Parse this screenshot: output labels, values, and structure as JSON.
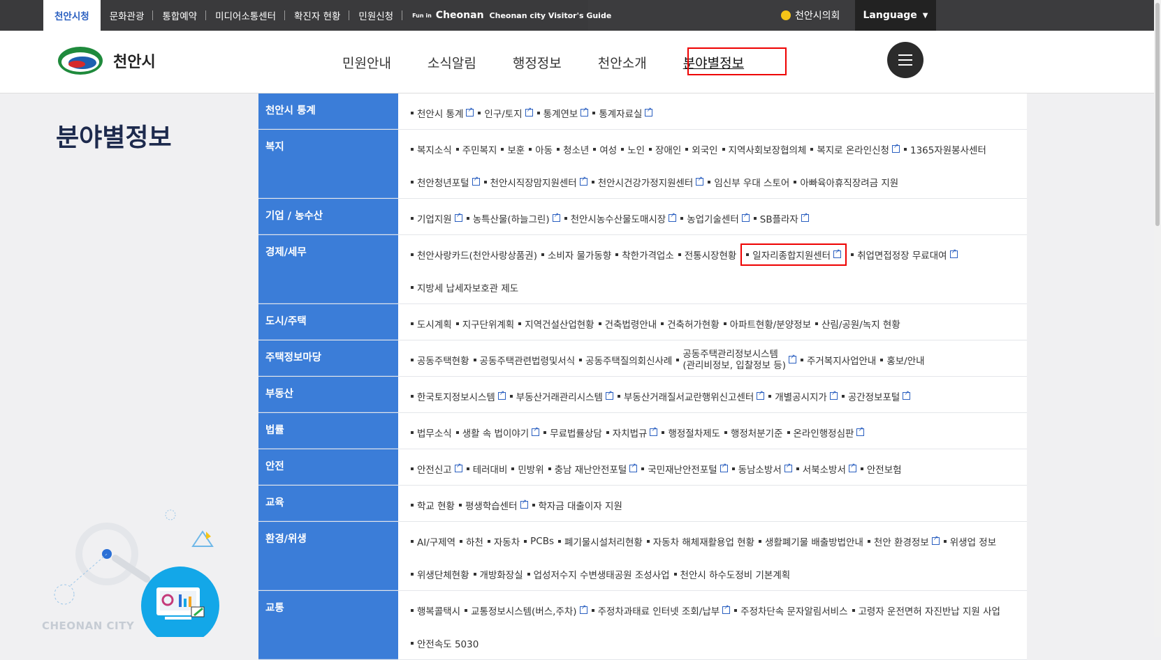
{
  "topbar": {
    "tabs": [
      "천안시청",
      "문화관광",
      "통합예약",
      "미디어소통센터",
      "확진자 현황",
      "민원신청"
    ],
    "visitor_guide": {
      "mark": "Fun in",
      "name": "Cheonan",
      "text": "Cheonan city Visitor's Guide"
    },
    "council": "천안시의회",
    "language": "Language"
  },
  "header": {
    "logo_text": "천안시",
    "gnb": [
      "민원안내",
      "소식알림",
      "행정정보",
      "천안소개",
      "분야별정보"
    ]
  },
  "page_title": "분야별정보",
  "city_label": "CHEONAN CITY",
  "categories": [
    {
      "title": "천안시 통계",
      "lines": [
        [
          [
            "천안시 통계",
            true
          ],
          [
            "인구/토지",
            true
          ],
          [
            "통계연보",
            true
          ],
          [
            "통계자료실",
            true
          ]
        ]
      ]
    },
    {
      "title": "복지",
      "lines": [
        [
          [
            "복지소식",
            false
          ],
          [
            "주민복지",
            false
          ],
          [
            "보훈",
            false
          ],
          [
            "아동",
            false
          ],
          [
            "청소년",
            false
          ],
          [
            "여성",
            false
          ],
          [
            "노인",
            false
          ],
          [
            "장애인",
            false
          ],
          [
            "외국인",
            false
          ],
          [
            "지역사회보장협의체",
            false
          ],
          [
            "복지로 온라인신청",
            true
          ],
          [
            "1365자원봉사센터",
            false
          ]
        ],
        [
          [
            "천안청년포털",
            true
          ],
          [
            "천안시직장맘지원센터",
            true
          ],
          [
            "천안시건강가정지원센터",
            true
          ],
          [
            "임신부 우대 스토어",
            false
          ],
          [
            "아빠육아휴직장려금 지원",
            false
          ]
        ]
      ]
    },
    {
      "title": "기업 / 농수산",
      "lines": [
        [
          [
            "기업지원",
            true
          ],
          [
            "농특산물(하늘그린)",
            true
          ],
          [
            "천안시농수산물도매시장",
            true
          ],
          [
            "농업기술센터",
            true
          ],
          [
            "SB플라자",
            true
          ]
        ]
      ]
    },
    {
      "title": "경제/세무",
      "lines": [
        [
          [
            "천안사랑카드(천안사랑상품권)",
            false
          ],
          [
            "소비자 물가동향",
            false
          ],
          [
            "착한가격업소",
            false
          ],
          [
            "전통시장현황",
            false
          ],
          [
            "일자리종합지원센터",
            true,
            "hl"
          ],
          [
            "취업면접정장 무료대여",
            true
          ]
        ],
        [
          [
            "지방세 납세자보호관 제도",
            false
          ]
        ]
      ]
    },
    {
      "title": "도시/주택",
      "lines": [
        [
          [
            "도시계획",
            false
          ],
          [
            "지구단위계획",
            false
          ],
          [
            "지역건설산업현황",
            false
          ],
          [
            "건축법령안내",
            false
          ],
          [
            "건축허가현황",
            false
          ],
          [
            "아파트현황/분양정보",
            false
          ],
          [
            "산림/공원/녹지 현황",
            false
          ]
        ]
      ]
    },
    {
      "title": "주택정보마당",
      "lines": [
        [
          [
            "공동주택현황",
            false
          ],
          [
            "공동주택관련법령및서식",
            false
          ],
          [
            "공동주택질의회신사례",
            false
          ],
          [
            "공동주택관리정보시스템",
            true,
            "two",
            "(관리비정보, 입찰정보 등)"
          ],
          [
            "주거복지사업안내",
            false
          ],
          [
            "홍보/안내",
            false
          ]
        ]
      ]
    },
    {
      "title": "부동산",
      "lines": [
        [
          [
            "한국토지정보시스템",
            true
          ],
          [
            "부동산거래관리시스템",
            true
          ],
          [
            "부동산거래질서교란행위신고센터",
            true
          ],
          [
            "개별공시지가",
            true
          ],
          [
            "공간정보포털",
            true
          ]
        ]
      ]
    },
    {
      "title": "법률",
      "lines": [
        [
          [
            "법무소식",
            false
          ],
          [
            "생활 속 법이야기",
            true
          ],
          [
            "무료법률상담",
            false
          ],
          [
            "자치법규",
            true
          ],
          [
            "행정절차제도",
            false
          ],
          [
            "행정처분기준",
            false
          ],
          [
            "온라인행정심판",
            true
          ]
        ]
      ]
    },
    {
      "title": "안전",
      "lines": [
        [
          [
            "안전신고",
            true
          ],
          [
            "테러대비",
            false
          ],
          [
            "민방위",
            false
          ],
          [
            "충남 재난안전포털",
            true
          ],
          [
            "국민재난안전포털",
            true
          ],
          [
            "동남소방서",
            true
          ],
          [
            "서북소방서",
            true
          ],
          [
            "안전보험",
            false
          ]
        ]
      ]
    },
    {
      "title": "교육",
      "lines": [
        [
          [
            "학교 현황",
            false
          ],
          [
            "평생학습센터",
            true
          ],
          [
            "학자금 대출이자 지원",
            false
          ]
        ]
      ]
    },
    {
      "title": "환경/위생",
      "lines": [
        [
          [
            "AI/구제역",
            false
          ],
          [
            "하천",
            false
          ],
          [
            "자동차",
            false
          ],
          [
            "PCBs",
            false
          ],
          [
            "폐기물시설처리현황",
            false
          ],
          [
            "자동차 해체재활용업 현황",
            false
          ],
          [
            "생활폐기물 배출방법안내",
            false
          ],
          [
            "천안 환경정보",
            true
          ],
          [
            "위생업 정보",
            false
          ]
        ],
        [
          [
            "위생단체현황",
            false
          ],
          [
            "개방화장실",
            false
          ],
          [
            "업성저수지 수변생태공원 조성사업",
            false
          ],
          [
            "천안시 하수도정비 기본계획",
            false
          ]
        ]
      ]
    },
    {
      "title": "교통",
      "lines": [
        [
          [
            "행복콜택시",
            false
          ],
          [
            "교통정보시스템(버스,주차)",
            true
          ],
          [
            "주정차과태료 인터넷 조회/납부",
            true
          ],
          [
            "주정차단속 문자알림서비스",
            false
          ],
          [
            "고령자 운전면허 자진반납 지원 사업",
            false
          ]
        ],
        [
          [
            "안전속도 5030",
            false
          ]
        ]
      ]
    }
  ]
}
